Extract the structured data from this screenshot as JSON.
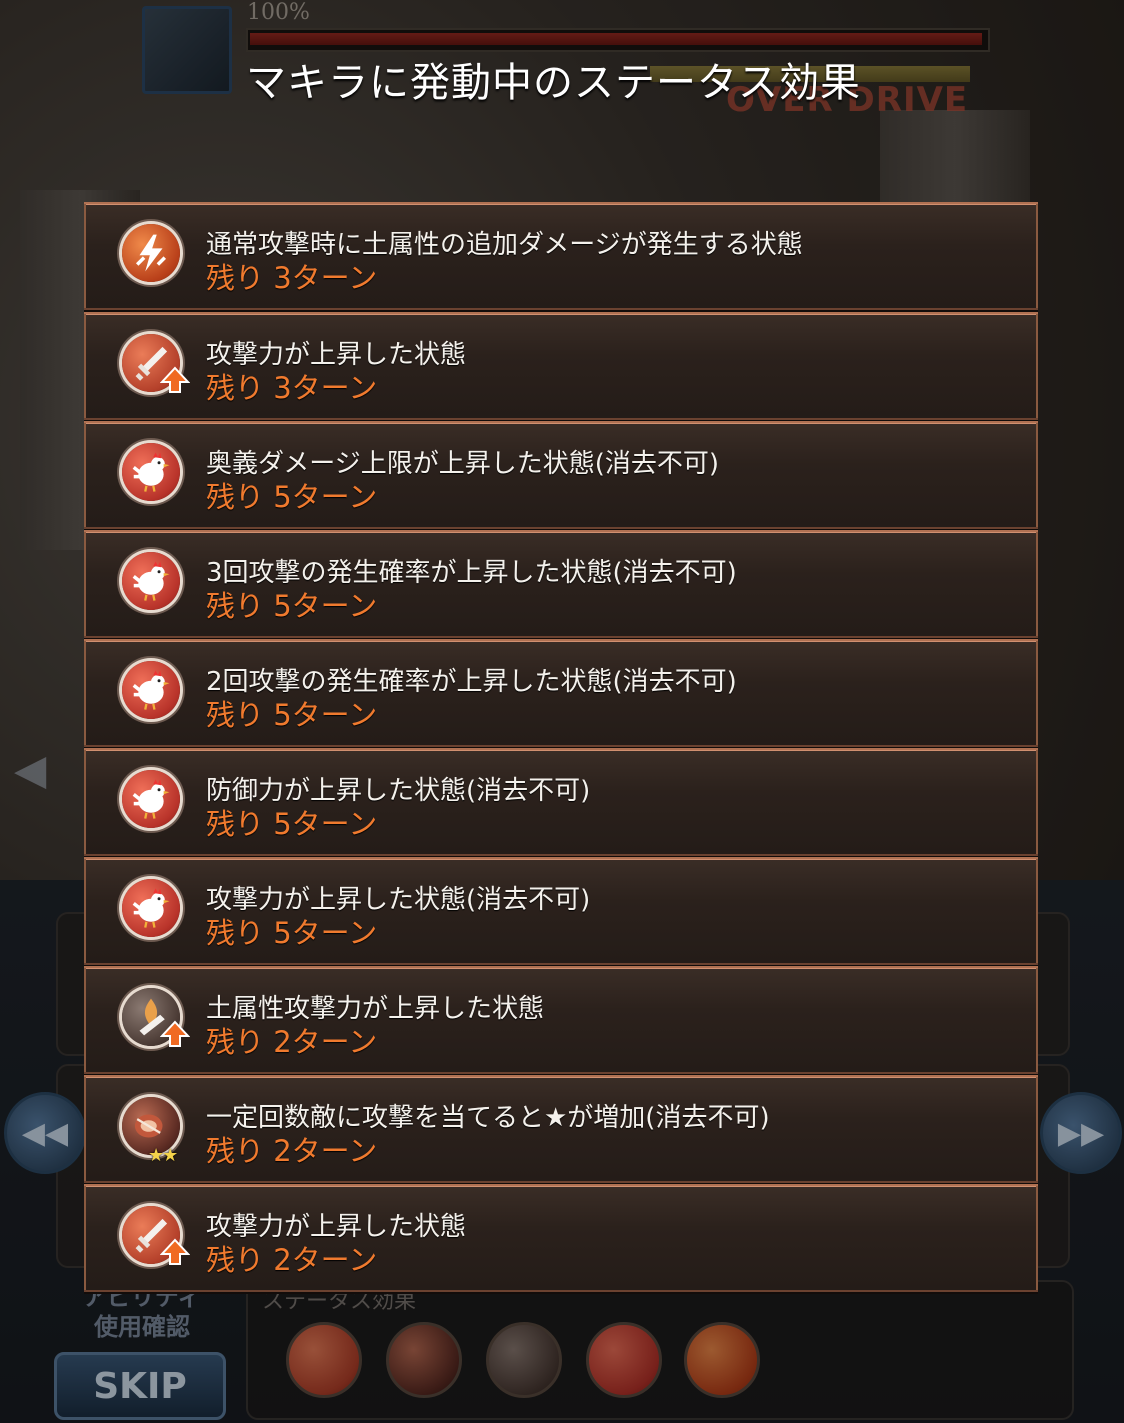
{
  "dialog": {
    "title": "マキラに発動中のステータス効果"
  },
  "hud": {
    "hp_percent": "100%",
    "overdrive_label": "OVER DRIVE"
  },
  "effects": [
    {
      "icon": "lightning-icon",
      "description": "通常攻撃時に土属性の追加ダメージが発生する状態",
      "turns": "残り 3ターン"
    },
    {
      "icon": "sword-up-icon",
      "description": "攻撃力が上昇した状態",
      "turns": "残り 3ターン"
    },
    {
      "icon": "chicken-icon",
      "description": "奥義ダメージ上限が上昇した状態(消去不可)",
      "turns": "残り 5ターン"
    },
    {
      "icon": "chicken-icon",
      "description": "3回攻撃の発生確率が上昇した状態(消去不可)",
      "turns": "残り 5ターン"
    },
    {
      "icon": "chicken-icon",
      "description": "2回攻撃の発生確率が上昇した状態(消去不可)",
      "turns": "残り 5ターン"
    },
    {
      "icon": "chicken-icon",
      "description": "防御力が上昇した状態(消去不可)",
      "turns": "残り 5ターン"
    },
    {
      "icon": "chicken-icon",
      "description": "攻撃力が上昇した状態(消去不可)",
      "turns": "残り 5ターン"
    },
    {
      "icon": "earth-sword-up-icon",
      "description": "土属性攻撃力が上昇した状態",
      "turns": "残り 2ターン"
    },
    {
      "icon": "drum-stars-icon",
      "description": "一定回数敵に攻撃を当てると★が増加(消去不可)",
      "turns": "残り 2ターン"
    },
    {
      "icon": "sword-up-icon",
      "description": "攻撃力が上昇した状態",
      "turns": "残り 2ターン"
    }
  ],
  "bottom": {
    "ability_label_line1": "アビリティ",
    "ability_label_line2": "使用確認",
    "skip_label": "SKIP",
    "status_panel_title": "ステータス効果"
  },
  "colors": {
    "turns_text": "#f07a2e",
    "row_border": "#b07152",
    "title_text": "#ffffff"
  }
}
